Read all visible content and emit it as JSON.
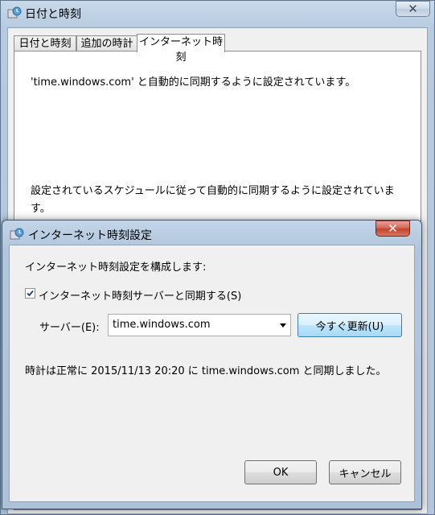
{
  "outer_window": {
    "title": "日付と時刻",
    "close_label": "✕",
    "tabs": [
      {
        "label": "日付と時刻"
      },
      {
        "label": "追加の時計"
      },
      {
        "label": "インターネット時刻"
      }
    ],
    "panel_text_1": "'time.windows.com' と自動的に同期するように設定されています。",
    "panel_text_2": "設定されているスケジュールに従って自動的に同期するように設定されています。"
  },
  "dialog": {
    "title": "インターネット時刻設定",
    "close_label": "✕",
    "heading": "インターネット時刻設定を構成します:",
    "sync_checkbox": {
      "label": "インターネット時刻サーバーと同期する(S)",
      "checked": true
    },
    "server_label": "サーバー(E):",
    "server_value": "time.windows.com",
    "update_now_label": "今すぐ更新(U)",
    "status_text": "時計は正常に 2015/11/13 20:20 に time.windows.com と同期しました。",
    "ok_label": "OK",
    "cancel_label": "キャンセル"
  },
  "icons": {
    "window_icon": "clock-globe-icon",
    "check": "checkmark-icon",
    "dropdown": "chevron-down-icon"
  },
  "colors": {
    "close_red": "#c2432b",
    "accent_blue": "#3c7fb1"
  }
}
